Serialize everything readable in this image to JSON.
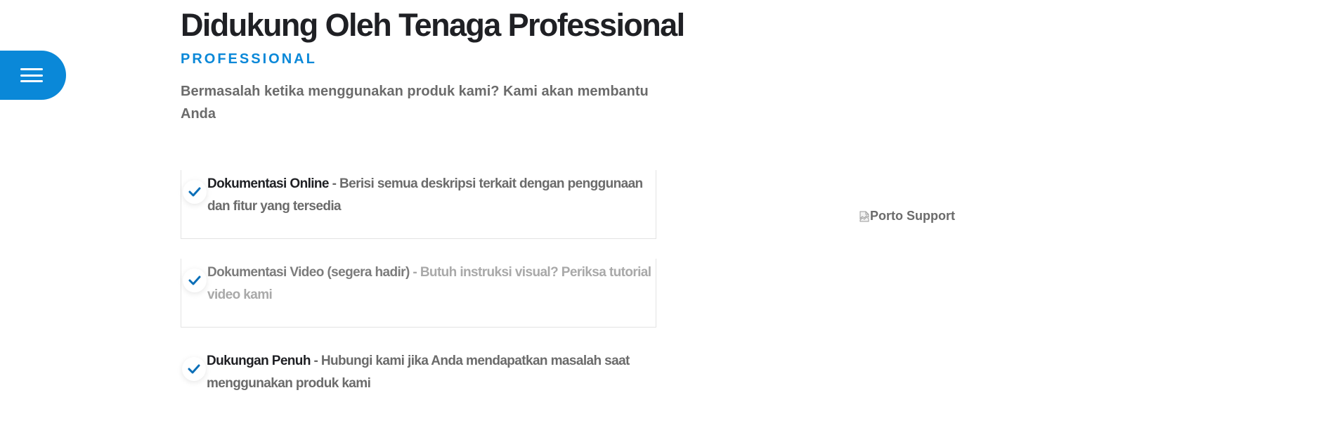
{
  "menu": {
    "icon": "hamburger-menu-icon",
    "color": "#0a88d8"
  },
  "section": {
    "title": "Didukung Oleh Tenaga Professional",
    "subtitle": "PROFESSIONAL",
    "lead": "Bermasalah ketika menggunakan produk kami? Kami akan membantu Anda"
  },
  "features": [
    {
      "icon": "checkmark-icon",
      "name": "Dokumentasi Online",
      "separator": " - ",
      "description": "Berisi semua deskripsi terkait dengan penggunaan dan fitur yang tersedia"
    },
    {
      "icon": "checkmark-icon",
      "name": "Dokumentasi Video (segera hadir)",
      "separator": " - ",
      "description": "Butuh instruksi visual? Periksa tutorial video kami"
    },
    {
      "icon": "checkmark-icon",
      "name": "Dukungan Penuh",
      "separator": " - ",
      "description": "Hubungi kami jika Anda mendapatkan masalah saat menggunakan produk kami"
    }
  ],
  "support_image": {
    "alt": "Porto Support",
    "icon": "broken-image-icon"
  },
  "colors": {
    "accent": "#0a88d8",
    "heading": "#1f2024",
    "body": "#6b6b6b",
    "muted": "#a9a9a9"
  }
}
